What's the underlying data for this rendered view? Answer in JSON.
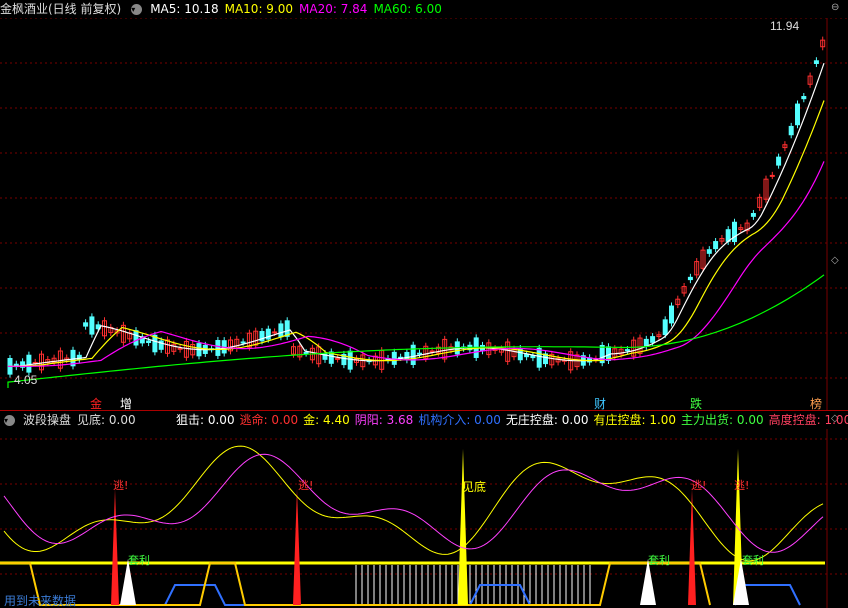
{
  "main_header": {
    "title": "金枫酒业(日线 前复权)",
    "ma5": "MA5: 10.18",
    "ma10": "MA10: 9.00",
    "ma20": "MA20: 7.84",
    "ma60": "MA60: 6.00",
    "colors": {
      "ma5": "#ffffff",
      "ma10": "#ffff00",
      "ma20": "#ff00ff",
      "ma60": "#00ff00"
    }
  },
  "main_chart": {
    "high_label": "11.94",
    "low_label": "4.05",
    "signals": [
      {
        "text": "金",
        "color": "#ff2020"
      },
      {
        "text": "增",
        "color": "#ffffff"
      },
      {
        "text": "财",
        "color": "#3ec6ff"
      },
      {
        "text": "跌",
        "color": "#40ff40"
      },
      {
        "text": "榜",
        "color": "#ffa050"
      }
    ]
  },
  "sub_header": {
    "title": "波段操盘",
    "jiandi": "见底: 0.00",
    "items": [
      {
        "text": "狙击: 0.00",
        "color": "#ffffff"
      },
      {
        "text": "逃命: 0.00",
        "color": "#ff3030"
      },
      {
        "text": "金: 4.40",
        "color": "#ffff00"
      },
      {
        "text": "阴阳: 3.68",
        "color": "#ff40ff"
      },
      {
        "text": "机构介入: 0.00",
        "color": "#3070ff"
      },
      {
        "text": "无庄控盘: 0.00",
        "color": "#ffffff"
      },
      {
        "text": "有庄控盘: 1.00",
        "color": "#ffff00"
      },
      {
        "text": "主力出货: 0.00",
        "color": "#40ff40"
      },
      {
        "text": "高度控盘: 1.00",
        "color": "#ff4060"
      }
    ]
  },
  "sub_chart": {
    "labels": [
      {
        "text": "逃!",
        "color": "#ff3030"
      },
      {
        "text": "逃!",
        "color": "#ff3030"
      },
      {
        "text": "见底",
        "color": "#ffff00"
      },
      {
        "text": "逃!",
        "color": "#ff3030"
      },
      {
        "text": "逃!",
        "color": "#ff3030"
      },
      {
        "text": "套利",
        "color": "#40ff40"
      },
      {
        "text": "套利",
        "color": "#40ff40"
      },
      {
        "text": "套利",
        "color": "#40ff40"
      }
    ],
    "footer_text": "用到未来数据"
  }
}
